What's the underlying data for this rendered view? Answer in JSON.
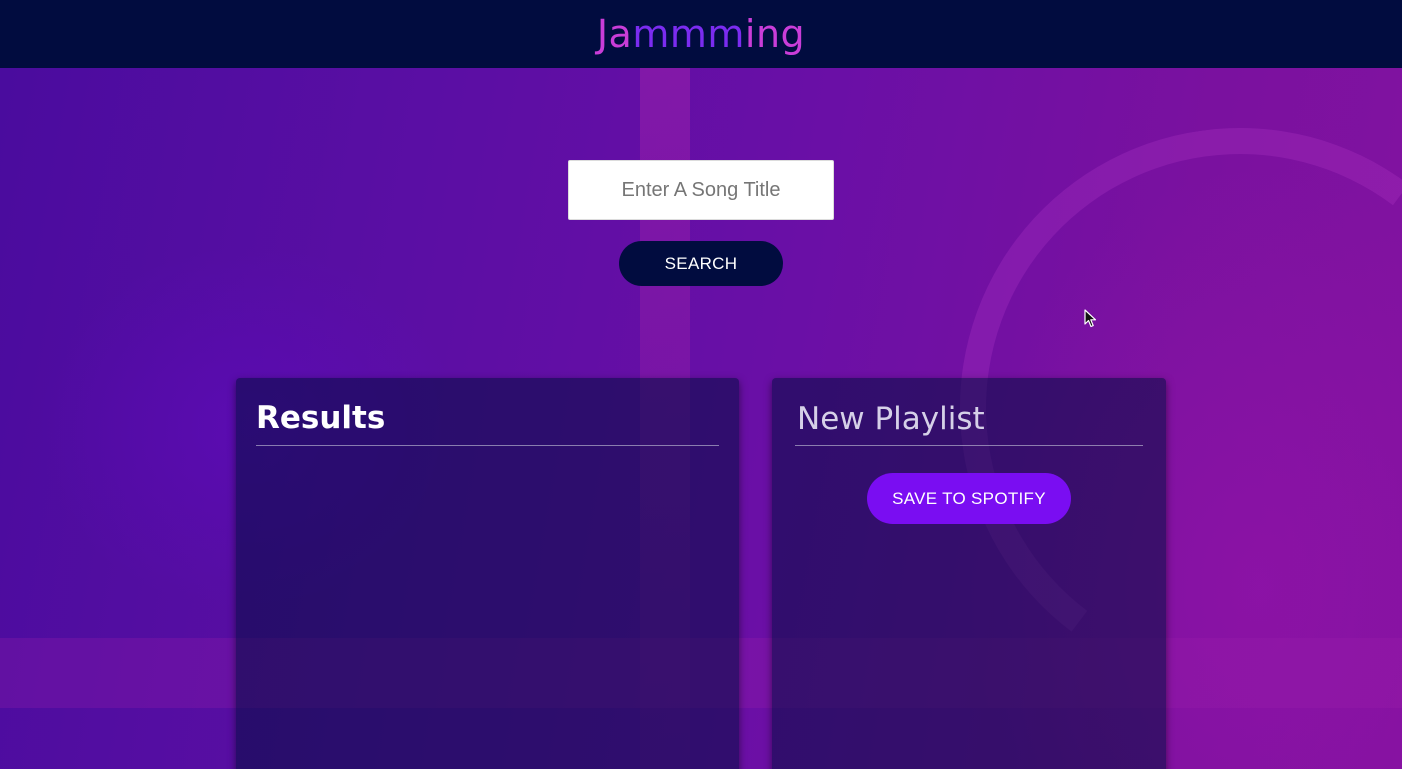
{
  "header": {
    "logo_start": "Ja",
    "logo_mid": "mmm",
    "logo_end": "ing"
  },
  "search": {
    "placeholder": "Enter A Song Title",
    "value": "",
    "button_label": "SEARCH"
  },
  "results": {
    "title": "Results",
    "tracks": []
  },
  "playlist": {
    "name": "New Playlist",
    "save_label": "SAVE TO SPOTIFY",
    "tracks": []
  },
  "colors": {
    "header_bg": "#010c3f",
    "logo_outer": "#c93dd8",
    "logo_mid": "#7b2cf0",
    "search_button_bg": "#010c3f",
    "save_button_bg": "#7a0df2"
  },
  "icons": {
    "cursor": "mouse-pointer-icon"
  }
}
